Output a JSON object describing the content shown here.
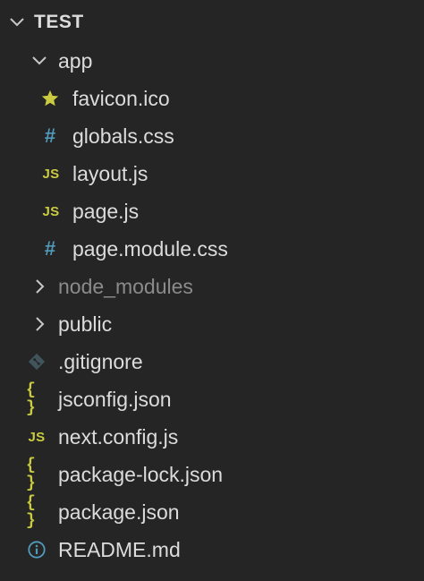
{
  "explorer": {
    "root": {
      "label": "TEST",
      "expanded": true
    },
    "items": [
      {
        "label": "app",
        "type": "folder",
        "expanded": true
      },
      {
        "label": "favicon.ico",
        "type": "file",
        "icon": "star-icon",
        "color": "#cbcb41"
      },
      {
        "label": "globals.css",
        "type": "file",
        "icon": "css-hash-icon",
        "color": "#519aba"
      },
      {
        "label": "layout.js",
        "type": "file",
        "icon": "js-icon",
        "color": "#cbcb41"
      },
      {
        "label": "page.js",
        "type": "file",
        "icon": "js-icon",
        "color": "#cbcb41"
      },
      {
        "label": "page.module.css",
        "type": "file",
        "icon": "css-hash-icon",
        "color": "#519aba"
      },
      {
        "label": "node_modules",
        "type": "folder",
        "expanded": false,
        "dimmed": true
      },
      {
        "label": "public",
        "type": "folder",
        "expanded": false
      },
      {
        "label": ".gitignore",
        "type": "file",
        "icon": "git-icon",
        "color": "#41535b"
      },
      {
        "label": "jsconfig.json",
        "type": "file",
        "icon": "json-braces-icon",
        "color": "#cbcb41"
      },
      {
        "label": "next.config.js",
        "type": "file",
        "icon": "js-icon",
        "color": "#cbcb41"
      },
      {
        "label": "package-lock.json",
        "type": "file",
        "icon": "json-braces-icon",
        "color": "#cbcb41"
      },
      {
        "label": "package.json",
        "type": "file",
        "icon": "json-braces-icon",
        "color": "#cbcb41"
      },
      {
        "label": "README.md",
        "type": "file",
        "icon": "info-icon",
        "color": "#519aba"
      }
    ],
    "icon_text": {
      "js": "JS",
      "hash": "#",
      "braces": "{ }"
    }
  }
}
